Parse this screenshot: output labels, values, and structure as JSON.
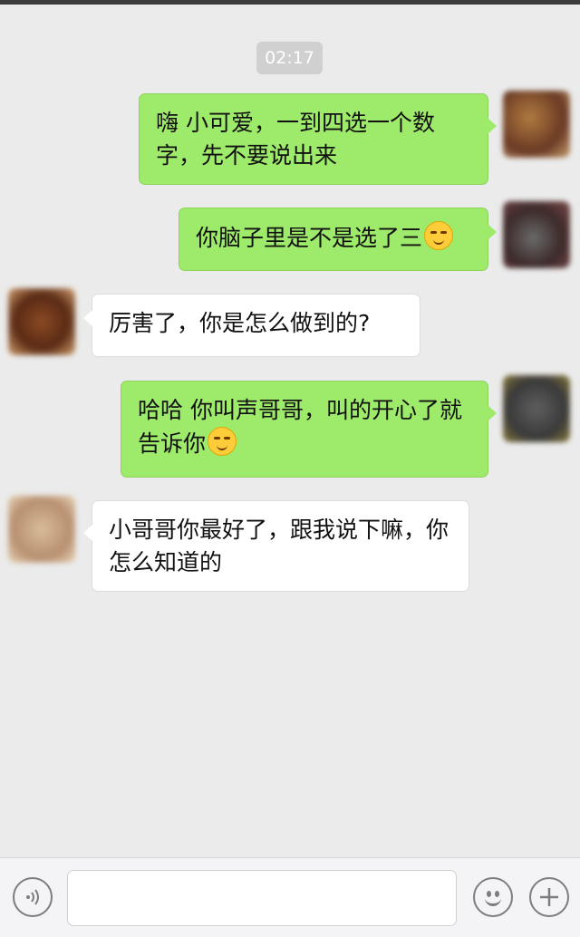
{
  "status": {
    "time": "02:17"
  },
  "messages": [
    {
      "side": "out",
      "text": "嗨  小可爱，一到四选一个数字，先不要说出来",
      "emoji": ""
    },
    {
      "side": "out",
      "text": "你脑子里是不是选了三",
      "emoji": "thinking-face-emoji"
    },
    {
      "side": "in",
      "text": "厉害了，你是怎么做到的?",
      "emoji": ""
    },
    {
      "side": "out",
      "text": "哈哈  你叫声哥哥，叫的开心了就告诉你",
      "emoji": "smirk-face-emoji"
    },
    {
      "side": "in",
      "text": "小哥哥你最好了，跟我说下嘛，你怎么知道的",
      "emoji": ""
    }
  ],
  "input_bar": {
    "voice_icon": "voice-icon",
    "input_value": "",
    "emoji_icon": "emoji-face-icon",
    "plus_icon": "plus-icon"
  },
  "colors": {
    "background": "#ebebeb",
    "outgoing_bubble": "#9eea6a",
    "incoming_bubble": "#ffffff"
  }
}
